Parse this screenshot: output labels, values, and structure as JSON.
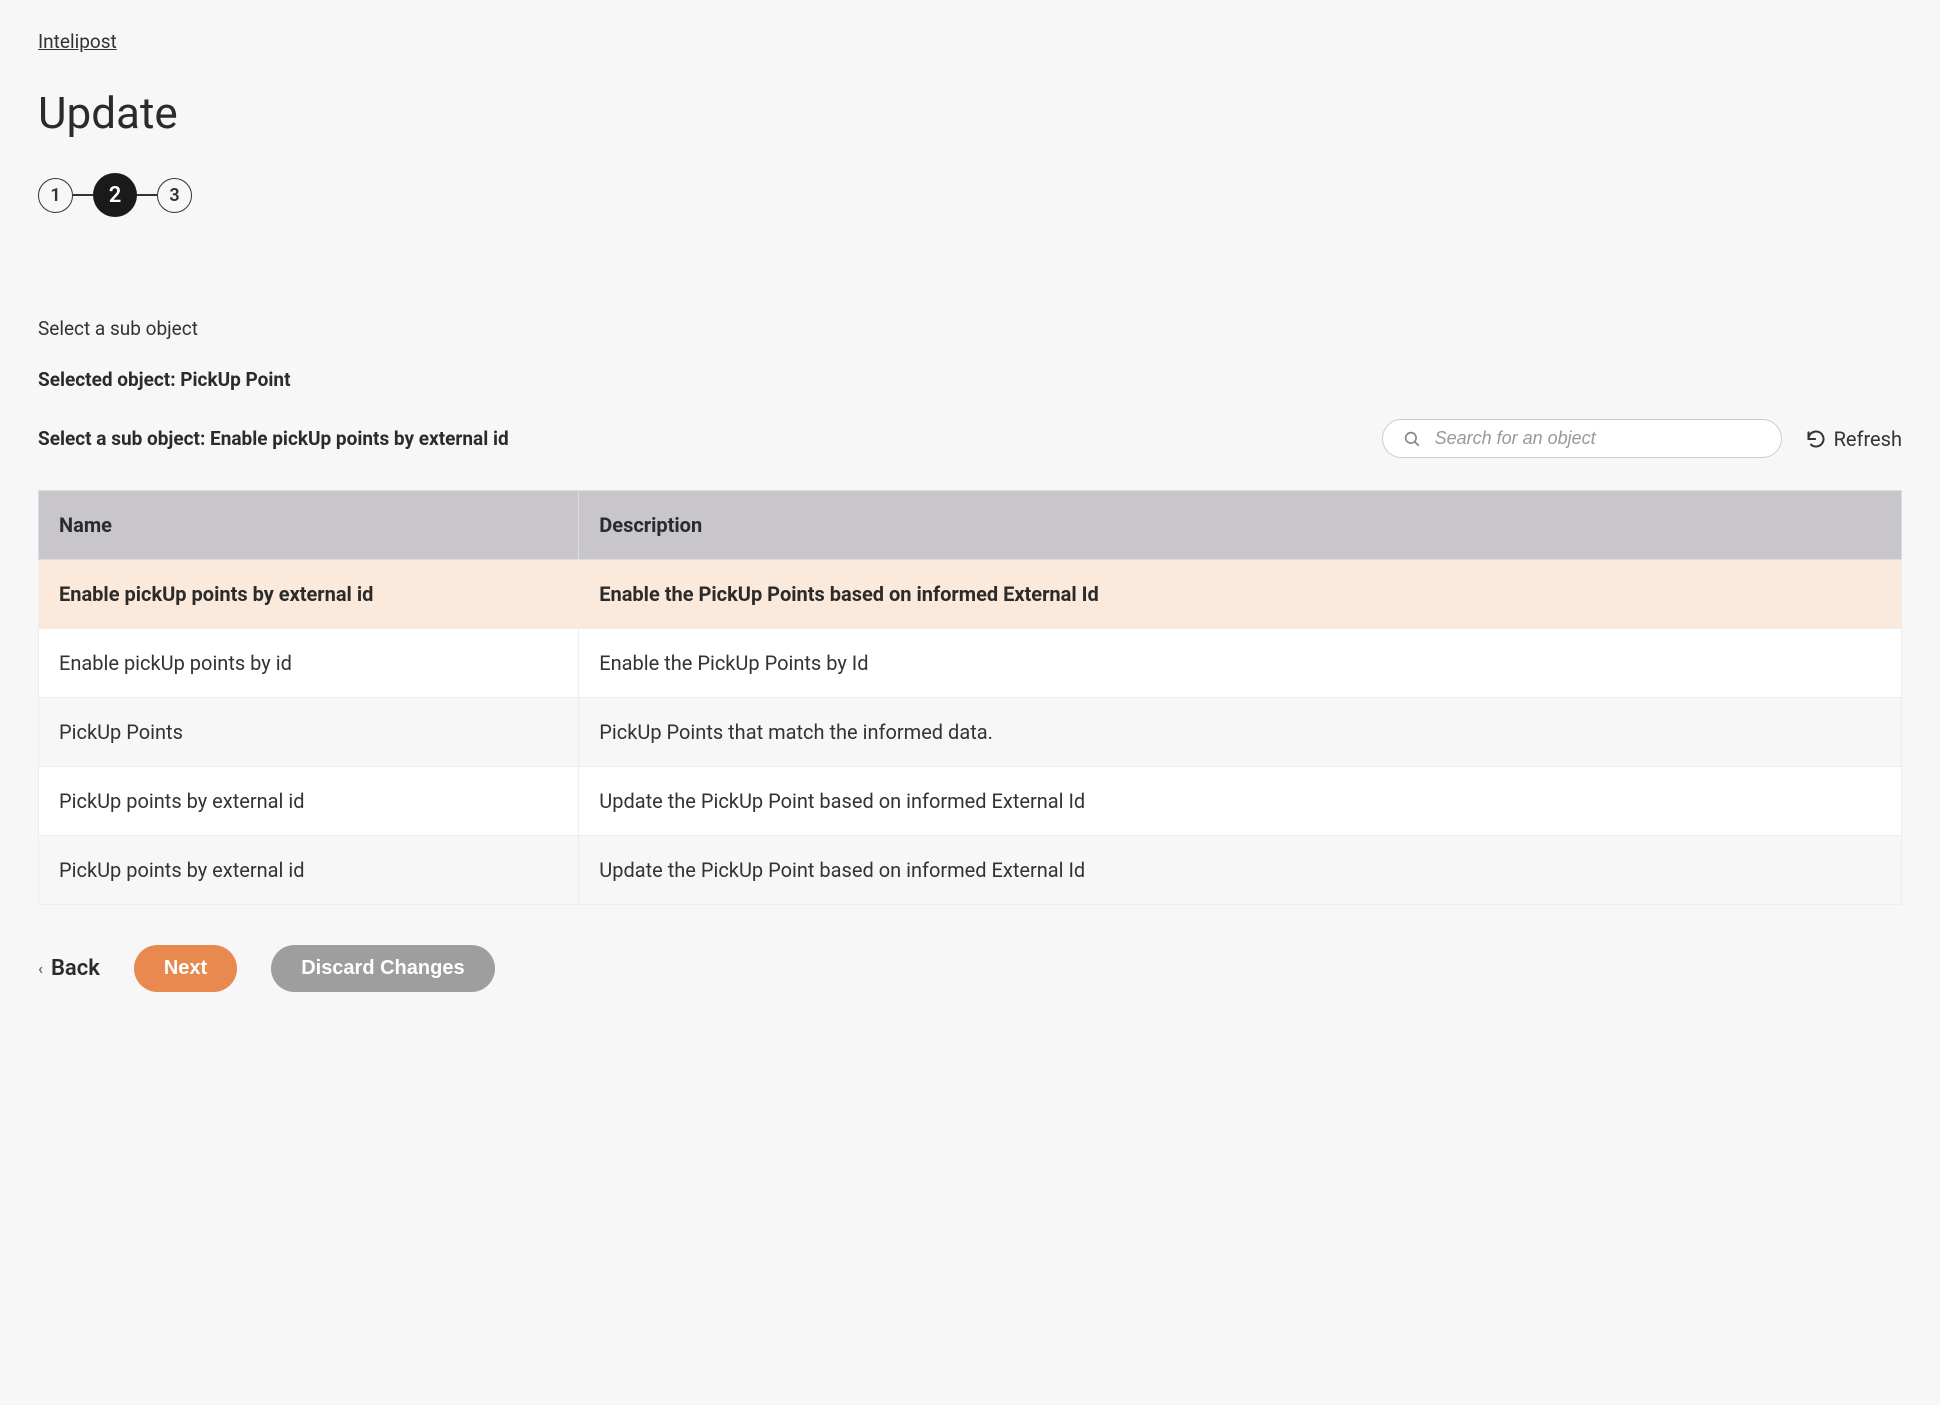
{
  "breadcrumb": "Intelipost",
  "pageTitle": "Update",
  "stepper": {
    "steps": [
      "1",
      "2",
      "3"
    ],
    "activeIndex": 1
  },
  "instruction": "Select a sub object",
  "selectedObjectLabel": "Selected object: PickUp Point",
  "subObjectLabel": "Select a sub object: Enable pickUp points by external id",
  "search": {
    "placeholder": "Search for an object",
    "value": ""
  },
  "refreshLabel": "Refresh",
  "table": {
    "headers": {
      "name": "Name",
      "description": "Description"
    },
    "rows": [
      {
        "name": "Enable pickUp points by external id",
        "description": "Enable the PickUp Points based on informed External Id",
        "selected": true
      },
      {
        "name": "Enable pickUp points by id",
        "description": "Enable the PickUp Points by Id",
        "selected": false
      },
      {
        "name": "PickUp Points",
        "description": "PickUp Points that match the informed data.",
        "selected": false
      },
      {
        "name": "PickUp points by external id",
        "description": "Update the PickUp Point based on informed External Id",
        "selected": false
      },
      {
        "name": "PickUp points by external id",
        "description": "Update the PickUp Point based on informed External Id",
        "selected": false
      }
    ]
  },
  "buttons": {
    "back": "Back",
    "next": "Next",
    "discard": "Discard Changes"
  }
}
